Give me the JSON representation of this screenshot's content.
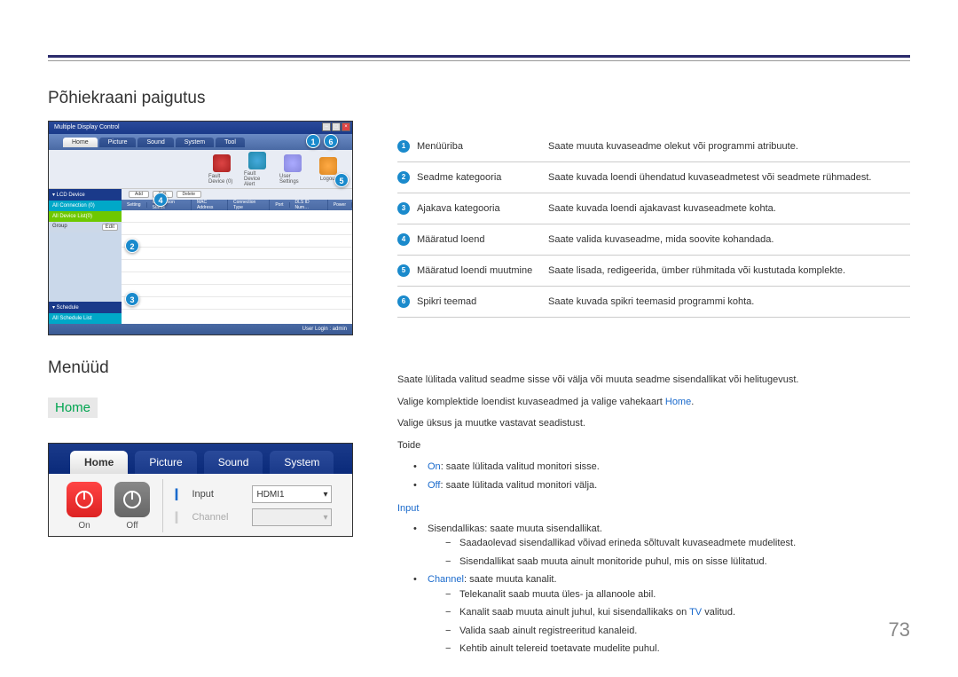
{
  "titles": {
    "main_layout": "Põhiekraani paigutus",
    "menus": "Menüüd",
    "home": "Home"
  },
  "screenshot1": {
    "window_title": "Multiple Display Control",
    "tabs": [
      "Home",
      "Picture",
      "Sound",
      "System",
      "Tool"
    ],
    "toolbar": [
      {
        "label": "Fault Device (0)"
      },
      {
        "label": "Fault Device Alert"
      },
      {
        "label": "User Settings"
      },
      {
        "label": "Logout"
      }
    ],
    "side": {
      "hdr1": "▾ LCD Device",
      "all_conn": "All Connection (0)",
      "all_list": "All Device List(0)",
      "group": "Group",
      "group_btn": "Edit",
      "hdr2": "▾ Schedule",
      "sched": "All Schedule List"
    },
    "grid_buttons": [
      "Add",
      "Edit",
      "Delete"
    ],
    "grid_cols": [
      "Setting",
      "Connection Status",
      "MAC Address",
      "Connection Type",
      "Port",
      "DLS ID Num…",
      "Power"
    ],
    "footer": "User Login : admin"
  },
  "screenshot2": {
    "tabs": [
      "Home",
      "Picture",
      "Sound",
      "System"
    ],
    "on": "On",
    "off": "Off",
    "field_input": "Input",
    "field_channel": "Channel",
    "input_value": "HDMI1"
  },
  "legend": [
    {
      "n": "1",
      "label": "Menüüriba",
      "desc": "Saate muuta kuvaseadme olekut või programmi atribuute."
    },
    {
      "n": "2",
      "label": "Seadme kategooria",
      "desc": "Saate kuvada loendi ühendatud kuvaseadmetest või seadmete rühmadest."
    },
    {
      "n": "3",
      "label": "Ajakava kategooria",
      "desc": "Saate kuvada loendi ajakavast kuvaseadmete kohta."
    },
    {
      "n": "4",
      "label": "Määratud loend",
      "desc": "Saate valida kuvaseadme, mida soovite kohandada."
    },
    {
      "n": "5",
      "label": "Määratud loendi muutmine",
      "desc": "Saate lisada, redigeerida, ümber rühmitada või kustutada komplekte."
    },
    {
      "n": "6",
      "label": "Spikri teemad",
      "desc": "Saate kuvada spikri teemasid programmi kohta."
    }
  ],
  "body": {
    "p1_a": "Saate lülitada valitud seadme sisse või välja või muuta seadme sisendallikat või helitugevust.",
    "p2_a": "Valige komplektide loendist kuvaseadmed ja valige vahekaart ",
    "p2_b": "Home",
    "p2_c": ".",
    "p3": "Valige üksus ja muutke vastavat seadistust.",
    "toide": "Toide",
    "on_hl": "On",
    "on_txt": ": saate lülitada valitud monitori sisse.",
    "off_hl": "Off",
    "off_txt": ": saate lülitada valitud monitori välja.",
    "input_hdr": "Input",
    "input1": "Sisendallikas: saate muuta sisendallikat.",
    "input1a": "Saadaolevad sisendallikad võivad erineda sõltuvalt kuvaseadmete mudelitest.",
    "input1b": "Sisendallikat saab muuta ainult monitoride puhul, mis on sisse lülitatud.",
    "ch_hl": "Channel",
    "ch_txt": ": saate muuta kanalit.",
    "ch_a": "Telekanalit saab muuta üles- ja allanoole abil.",
    "ch_b_a": "Kanalit saab muuta ainult juhul, kui sisendallikaks on ",
    "ch_b_hl": "TV",
    "ch_b_c": " valitud.",
    "ch_c": "Valida saab ainult registreeritud kanaleid.",
    "ch_d": "Kehtib ainult telereid toetavate mudelite puhul."
  },
  "page_number": "73"
}
